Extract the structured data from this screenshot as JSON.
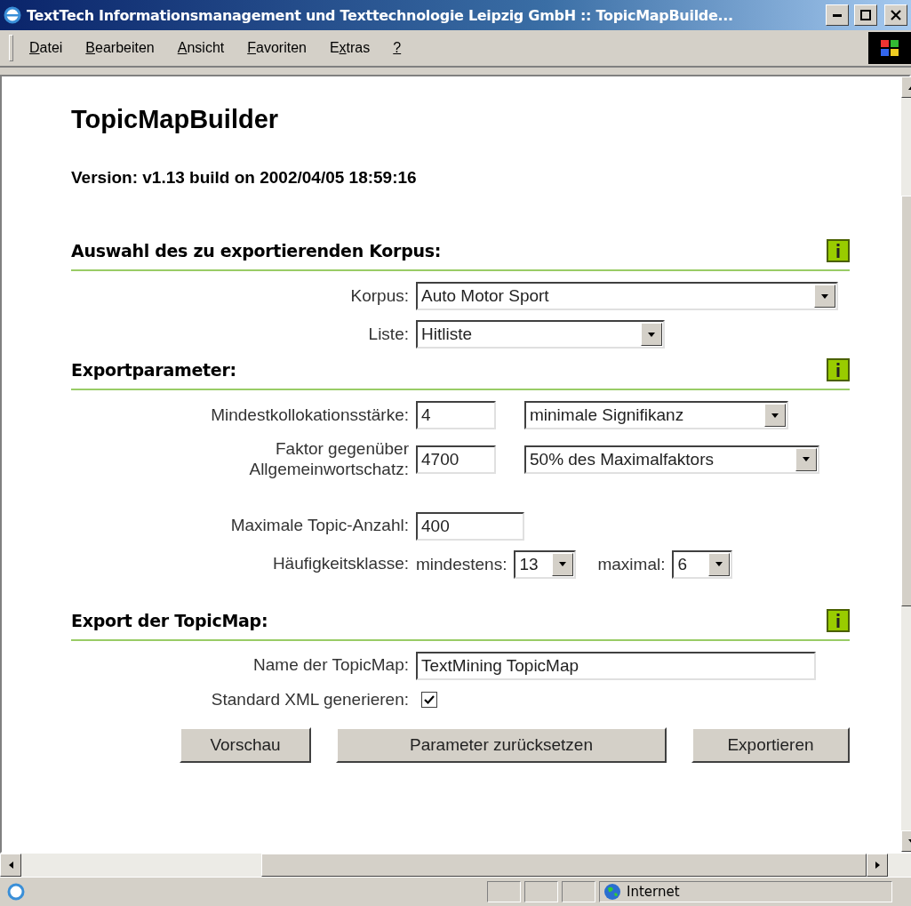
{
  "window": {
    "title": "TextTech Informationsmanagement und Texttechnologie Leipzig GmbH :: TopicMapBuilde..."
  },
  "menu": [
    {
      "key": "D",
      "after": "atei"
    },
    {
      "key": "B",
      "after": "earbeiten"
    },
    {
      "key": "A",
      "after": "nsicht"
    },
    {
      "key": "F",
      "after": "avoriten"
    },
    {
      "before": "E",
      "key": "x",
      "after": "tras"
    },
    {
      "key": "?"
    }
  ],
  "page": {
    "title": "TopicMapBuilder",
    "version": "Version: v1.13 build on 2002/04/05 18:59:16"
  },
  "sections": [
    {
      "heading": "Auswahl des zu exportierenden Korpus:",
      "rows": [
        {
          "kind": "select",
          "label": "Korpus:",
          "value": "Auto Motor Sport"
        },
        {
          "kind": "select",
          "label": "Liste:",
          "value": "Hitliste"
        }
      ]
    },
    {
      "heading": "Exportparameter:",
      "rows": [
        {
          "kind": "input_select",
          "label": "Mindestkollokationsstärke:",
          "value": "4",
          "option": "minimale Signifikanz"
        },
        {
          "kind": "input_select",
          "label": "Faktor gegenüber Allgemeinwortschatz:",
          "value": "4700",
          "option": "50% des Maximalfaktors"
        },
        {
          "kind": "input",
          "label": "Maximale Topic-Anzahl:",
          "value": "400"
        },
        {
          "kind": "range",
          "label": "Häufigkeitsklasse:",
          "min_label": "mindestens:",
          "min_value": "13",
          "max_label": "maximal:",
          "max_value": "6"
        }
      ]
    },
    {
      "heading": "Export der TopicMap:",
      "rows": [
        {
          "kind": "input",
          "label": "Name der TopicMap:",
          "value": "TextMining TopicMap"
        },
        {
          "kind": "checkbox",
          "label": "Standard XML generieren:",
          "checked": true
        }
      ]
    }
  ],
  "buttons": [
    "Vorschau",
    "Parameter zurücksetzen",
    "Exportieren"
  ],
  "status_bar": {
    "zone": "Internet"
  }
}
